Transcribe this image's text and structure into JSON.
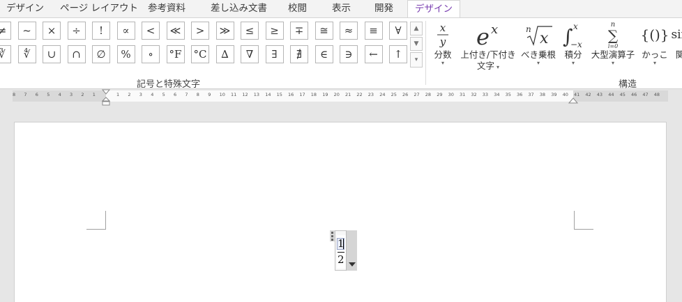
{
  "tabs": [
    {
      "label": "デザイン"
    },
    {
      "label": "ページ レイアウト"
    },
    {
      "label": "参考資料"
    },
    {
      "label": "差し込み文書"
    },
    {
      "label": "校閲"
    },
    {
      "label": "表示"
    },
    {
      "label": "開発"
    },
    {
      "label": "デザイン",
      "active": true
    }
  ],
  "symbols": {
    "row1": [
      "≠",
      "~",
      "×",
      "÷",
      "!",
      "∝",
      "<",
      "≪",
      ">",
      "≫",
      "≤",
      "≥",
      "∓",
      "≅",
      "≈",
      "≡",
      "∀"
    ],
    "row2": [
      "∛",
      "∜",
      "∪",
      "∩",
      "∅",
      "%",
      "∘",
      "°F",
      "°C",
      "∆",
      "∇",
      "∃",
      "∄",
      "∈",
      "∋",
      "←",
      "↑"
    ],
    "group_label": "記号と特殊文字"
  },
  "structures": {
    "items": [
      {
        "glyph": "x/y",
        "label": "分数",
        "label2": ""
      },
      {
        "glyph": "eˣ",
        "label": "上付き/下付き",
        "label2": "文字"
      },
      {
        "glyph": "ⁿ√x",
        "label": "べき乗根",
        "label2": ""
      },
      {
        "glyph": "∫",
        "label": "積分",
        "label2": ""
      },
      {
        "glyph": "∑",
        "label": "大型演算子",
        "label2": ""
      },
      {
        "glyph": "{()}",
        "label": "かっこ",
        "label2": ""
      },
      {
        "glyph": "sin",
        "label": "関",
        "label2": ""
      }
    ],
    "group_label": "構造"
  },
  "ruler": {
    "left_numbers": [
      "8",
      "7",
      "6",
      "5",
      "4",
      "3",
      "2",
      "1"
    ],
    "right_numbers": [
      "1",
      "2",
      "3",
      "4",
      "5",
      "6",
      "7",
      "8",
      "9",
      "10",
      "11",
      "12",
      "13",
      "14",
      "15",
      "16",
      "17",
      "18",
      "19",
      "20",
      "21",
      "22",
      "23",
      "24",
      "25",
      "26",
      "27",
      "28",
      "29",
      "30",
      "31",
      "32",
      "33",
      "34",
      "35",
      "36",
      "37",
      "38",
      "39",
      "40",
      "41",
      "42",
      "43",
      "44",
      "45",
      "46",
      "47",
      "48"
    ]
  },
  "equation": {
    "numerator": "1",
    "denominator": "2"
  },
  "colors": {
    "active_tab": "#7a3fb0",
    "ribbon_bg": "#ffffff",
    "workspace_bg": "#e6e6e6"
  }
}
